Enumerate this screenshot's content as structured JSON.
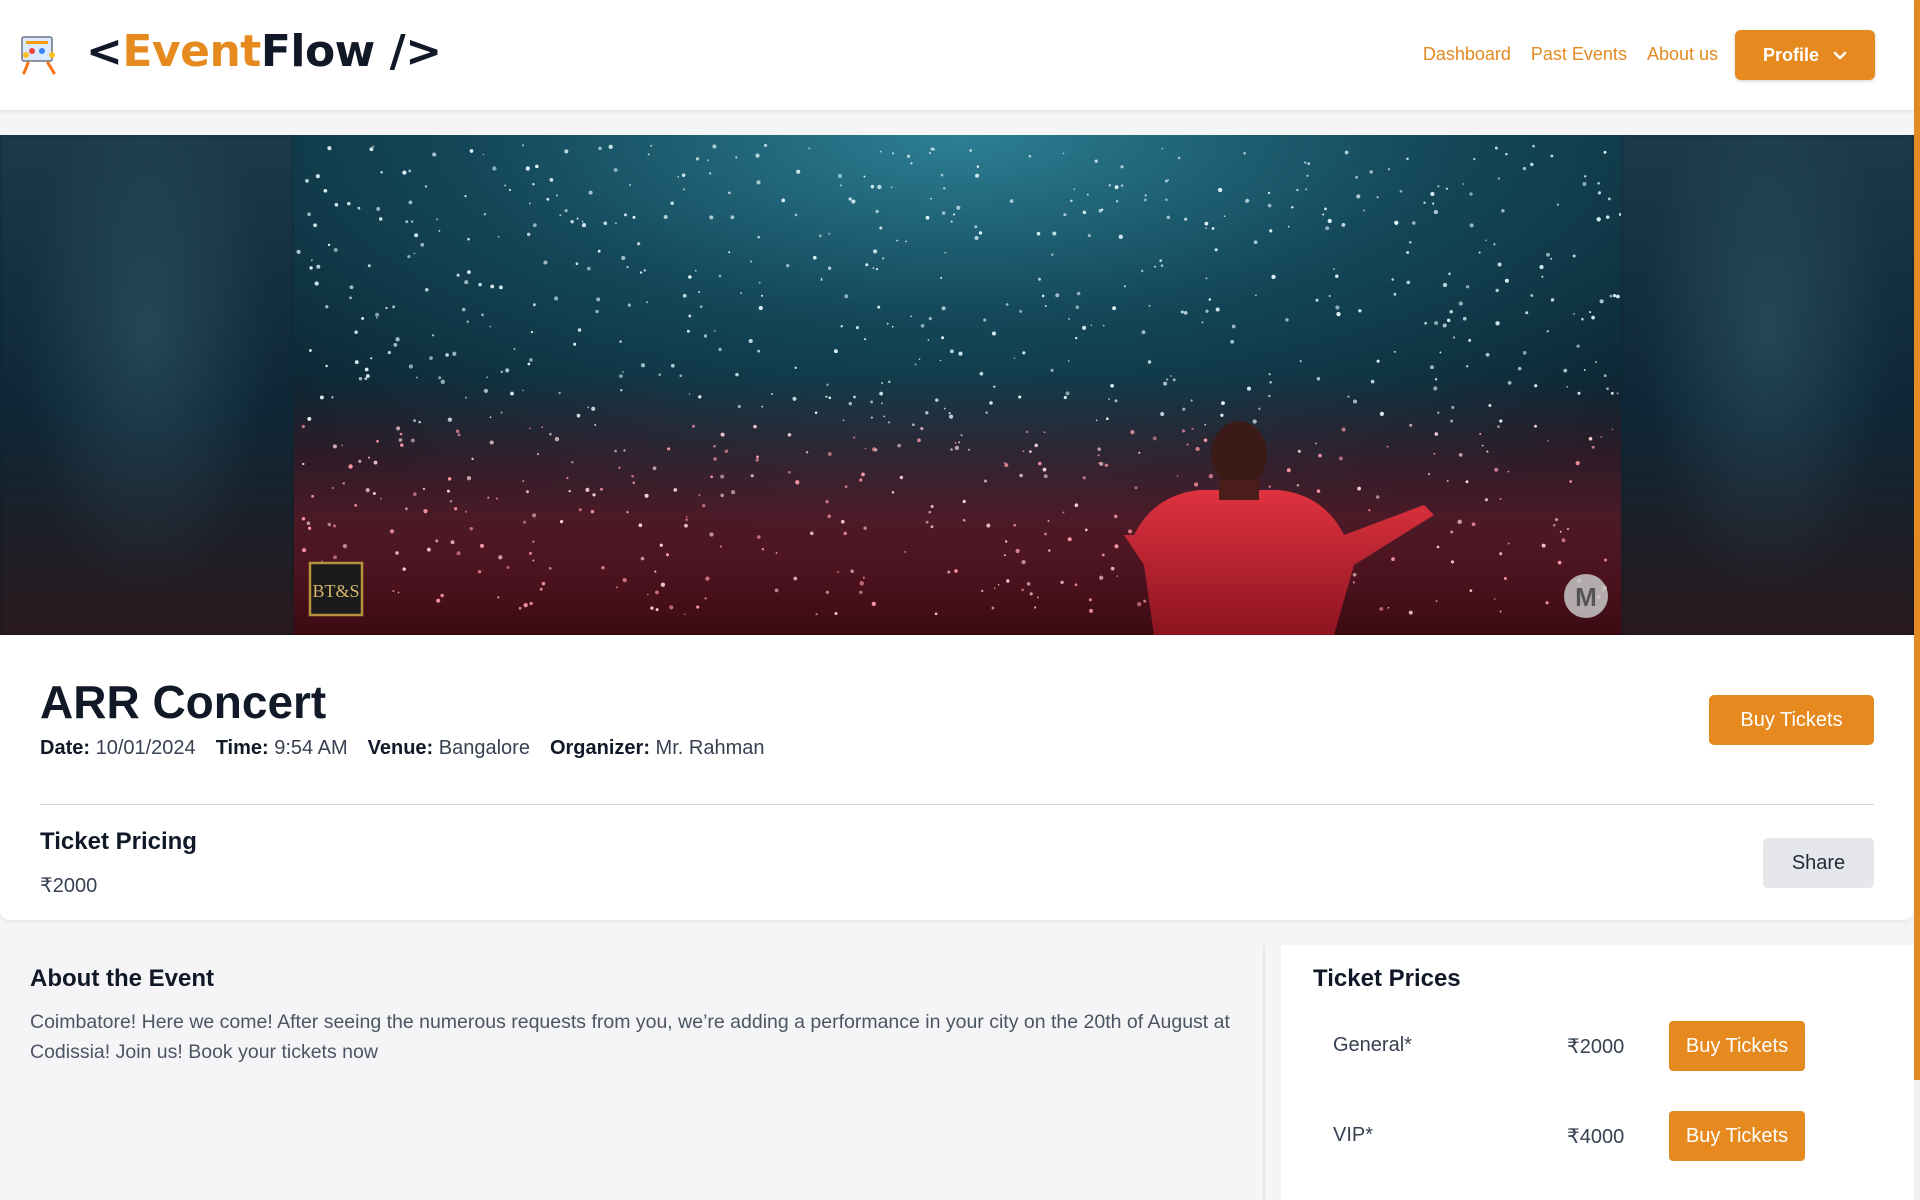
{
  "navbar": {
    "brand": {
      "lt": "<",
      "accent": "Event",
      "rest": "Flow />"
    },
    "links": [
      "Dashboard",
      "Past Events",
      "About us"
    ],
    "profile_label": "Profile"
  },
  "banner": {
    "logo_left": "BT&S",
    "logo_right": "M"
  },
  "event": {
    "title": "ARR Concert",
    "date_label": "Date:",
    "date": "10/01/2024",
    "time_label": "Time:",
    "time": "9:54 AM",
    "venue_label": "Venue:",
    "venue": "Bangalore",
    "organizer_label": "Organizer:",
    "organizer": "Mr. Rahman",
    "buy_label": "Buy Tickets",
    "pricing_title": "Ticket Pricing",
    "pricing_value": "₹2000",
    "share_label": "Share"
  },
  "about": {
    "title": "About the Event",
    "text": "Coimbatore! Here we come! After seeing the numerous requests from you, we’re adding a performance in your city on the 20th of August at Codissia! Join us! Book your tickets now"
  },
  "tickets": {
    "title": "Ticket Prices",
    "items": [
      {
        "name": "General*",
        "price": "₹2000",
        "buy_label": "Buy Tickets"
      },
      {
        "name": "VIP*",
        "price": "₹4000",
        "buy_label": "Buy Tickets"
      }
    ]
  },
  "colors": {
    "accent": "#e68a1f",
    "text": "#111827",
    "muted": "#4b5563"
  }
}
